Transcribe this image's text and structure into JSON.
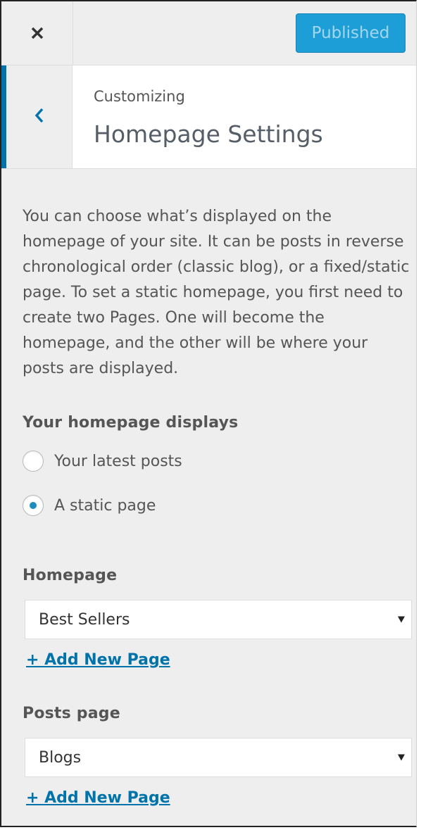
{
  "topbar": {
    "close_icon": "close-icon",
    "publish_label": "Published",
    "publish_color": "#1e9ed6"
  },
  "section": {
    "back_icon": "chevron-left-icon",
    "breadcrumb": "Customizing",
    "title": "Homepage Settings",
    "accent_color": "#0073aa"
  },
  "description": "You can choose what’s displayed on the homepage of your site. It can be posts in reverse chronological order (classic blog), or a fixed/static page. To set a static homepage, you first need to create two Pages. One will become the homepage, and the other will be where your posts are displayed.",
  "homepage_displays": {
    "label": "Your homepage displays",
    "options": [
      {
        "label": "Your latest posts",
        "checked": false
      },
      {
        "label": "A static page",
        "checked": true
      }
    ]
  },
  "homepage": {
    "label": "Homepage",
    "selected": "Best Sellers",
    "add_link": "+ Add New Page"
  },
  "posts_page": {
    "label": "Posts page",
    "selected": "Blogs",
    "add_link": "+ Add New Page"
  }
}
